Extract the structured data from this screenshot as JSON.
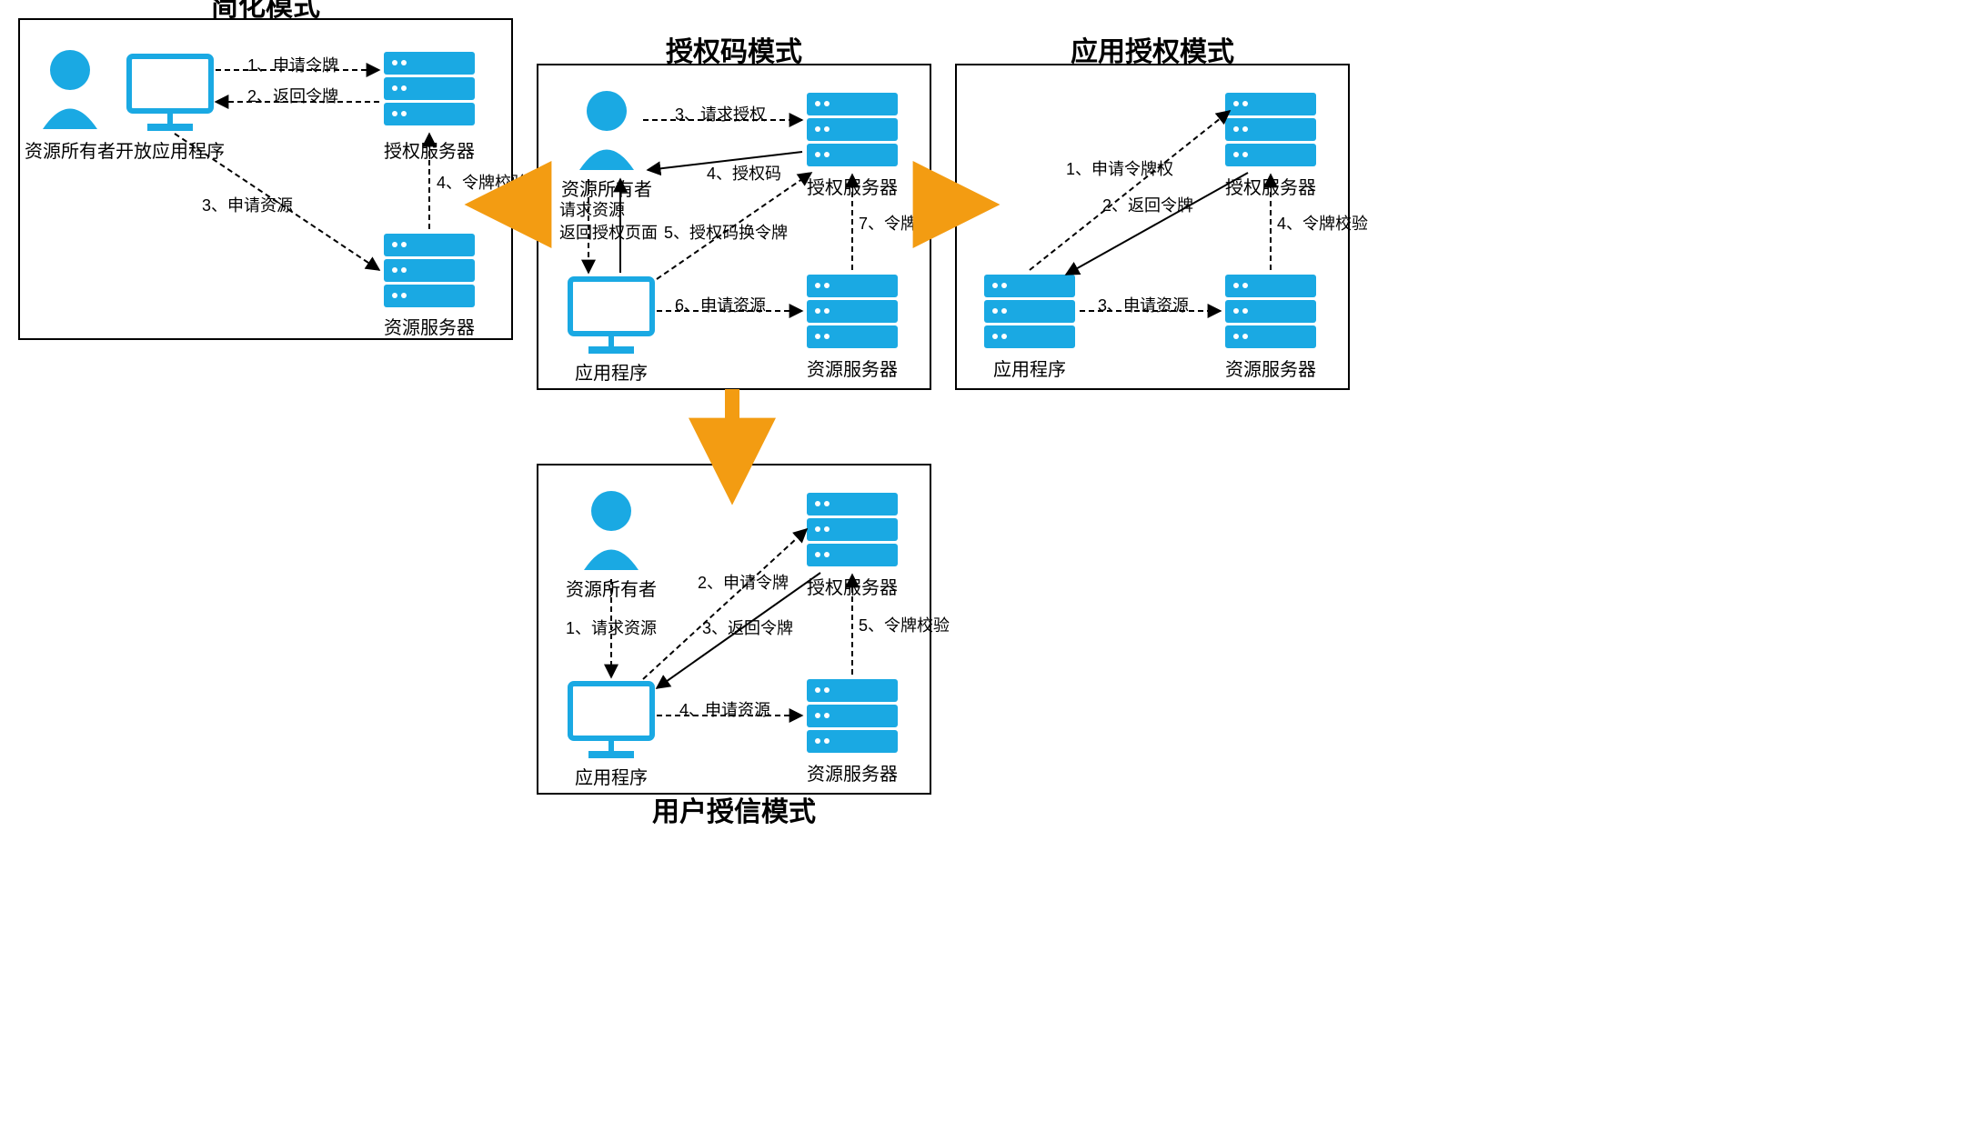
{
  "colors": {
    "accent": "#1AA9E3",
    "orange": "#F39C12",
    "border": "#000000"
  },
  "panels": {
    "simplified": {
      "title": "简化模式"
    },
    "authcode": {
      "title": "授权码模式"
    },
    "appauth": {
      "title": "应用授权模式"
    },
    "usercred": {
      "title": "用户授信模式"
    }
  },
  "actors": {
    "resource_owner": "资源所有者",
    "open_app": "开放应用程序",
    "app": "应用程序",
    "auth_server": "授权服务器",
    "res_server": "资源服务器"
  },
  "simplified": {
    "s1": "1、申请令牌",
    "s2": "2、返回令牌",
    "s3": "3、申请资源",
    "s4": "4、令牌校验"
  },
  "authcode": {
    "s1": "1、请求资源",
    "s2": "2、返回授权页面",
    "s3": "3、请求授权",
    "s4": "4、授权码",
    "s5": "5、授权码换令牌",
    "s6": "6、申请资源",
    "s7": "7、令牌校验"
  },
  "appauth": {
    "s1": "1、申请令牌权",
    "s2": "2、返回令牌",
    "s3": "3、申请资源",
    "s4": "4、令牌校验"
  },
  "usercred": {
    "s1": "1、请求资源",
    "s2": "2、申请令牌",
    "s3": "3、返回令牌",
    "s4": "4、申请资源",
    "s5": "5、令牌校验"
  }
}
